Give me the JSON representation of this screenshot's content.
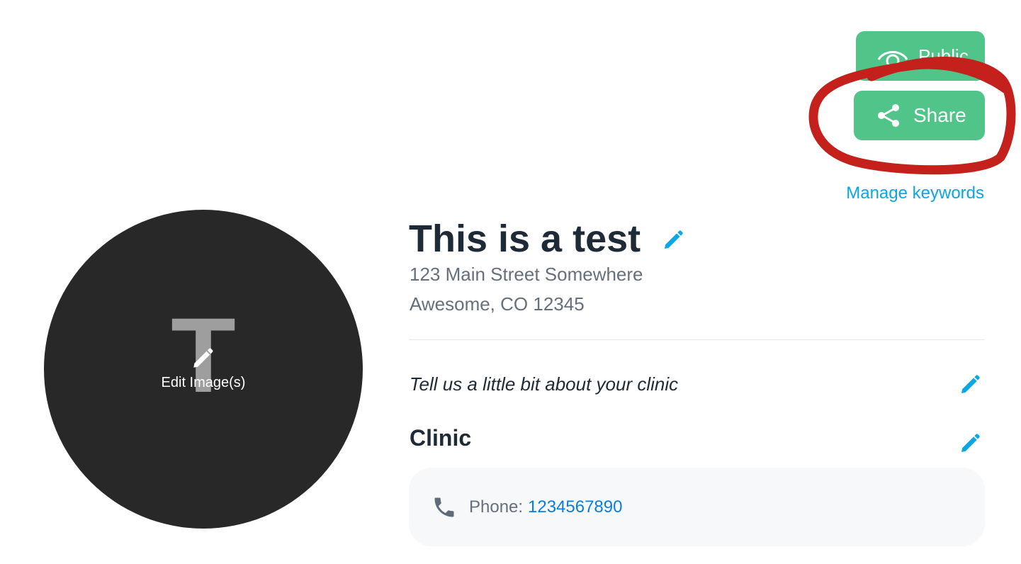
{
  "header": {
    "public_label": "Public",
    "share_label": "Share",
    "manage_keywords_label": "Manage keywords"
  },
  "avatar": {
    "letter": "T",
    "edit_label": "Edit Image(s)"
  },
  "profile": {
    "title": "This is a test",
    "address_line1": "123 Main Street Somewhere",
    "address_line2": "Awesome, CO 12345",
    "about_placeholder": "Tell us a little bit about your clinic",
    "section_heading": "Clinic"
  },
  "contact": {
    "phone_label": "Phone:",
    "phone_number": "1234567890"
  },
  "colors": {
    "accent_green": "#50c489",
    "link_blue": "#0aa6e6",
    "phone_blue": "#0a7de0",
    "annotation_red": "#c4201c",
    "avatar_bg": "#282828"
  },
  "icons": {
    "public": "eye-icon",
    "share": "share-icon",
    "edit": "pencil-icon",
    "phone": "phone-icon"
  }
}
